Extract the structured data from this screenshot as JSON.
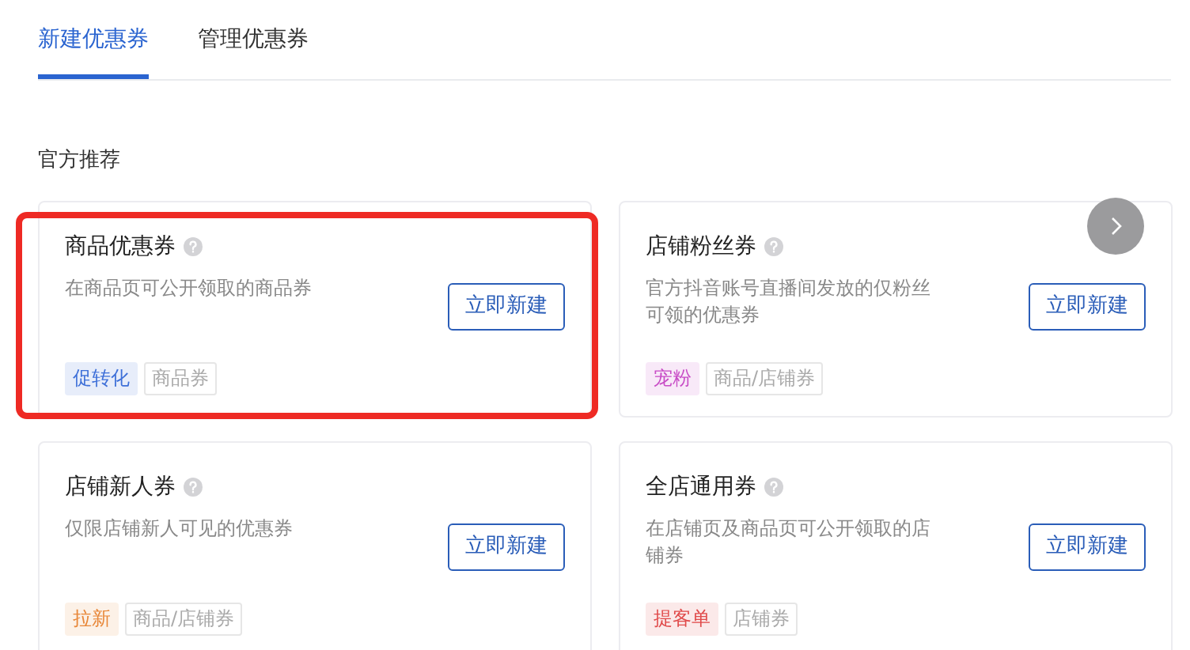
{
  "tabs": [
    {
      "label": "新建优惠券",
      "selected": true
    },
    {
      "label": "管理优惠券",
      "selected": false
    }
  ],
  "section_title": "官方推荐",
  "cards": [
    {
      "title": "商品优惠券",
      "description": "在商品页可公开领取的商品券",
      "button": "立即新建",
      "highlighted": true,
      "tags": [
        {
          "label": "促转化",
          "color": "#3d6fd8"
        },
        {
          "label": "商品券"
        }
      ]
    },
    {
      "title": "店铺粉丝券",
      "description": "官方抖音账号直播间发放的仅粉丝可领的优惠券",
      "button": "立即新建",
      "highlighted": false,
      "tags": [
        {
          "label": "宠粉",
          "color": "#c84cc6"
        },
        {
          "label": "商品/店铺券"
        }
      ]
    },
    {
      "title": "店铺新人券",
      "description": "仅限店铺新人可见的优惠券",
      "button": "立即新建",
      "highlighted": false,
      "tags": [
        {
          "label": "拉新",
          "color": "#e8883a"
        },
        {
          "label": "商品/店铺券"
        }
      ]
    },
    {
      "title": "全店通用券",
      "description": "在店铺页及商品页可公开领取的店铺券",
      "button": "立即新建",
      "highlighted": false,
      "tags": [
        {
          "label": "提客单",
          "color": "#e04a4a"
        },
        {
          "label": "店铺券"
        }
      ]
    }
  ]
}
